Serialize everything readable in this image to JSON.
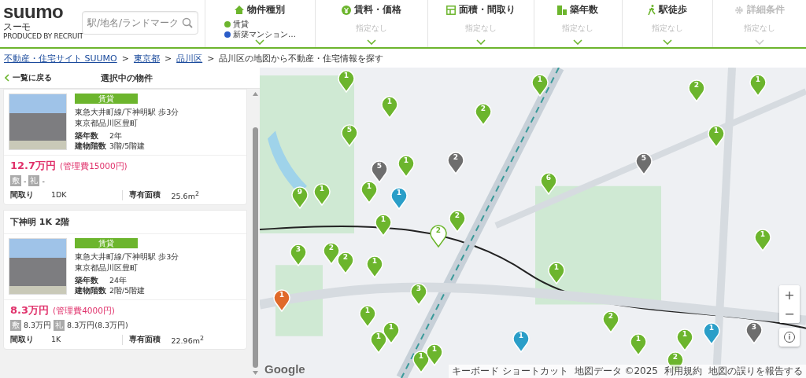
{
  "header": {
    "logo": "suumo",
    "logo_kana": "スーモ",
    "logo_credit": "PRODUCED BY RECRUIT",
    "search": {
      "placeholder": "駅/地名/ランドマーク"
    },
    "filters": [
      {
        "kind": "type",
        "label": "物件種別",
        "disabled": false,
        "values": [
          {
            "text": "賃貸",
            "color": "#6cb52d"
          },
          {
            "text": "新築マンション…",
            "color": "#2a5cc8"
          }
        ]
      },
      {
        "kind": "rent",
        "label": "賃料・価格",
        "disabled": false,
        "values": [
          {
            "text": "指定なし"
          }
        ]
      },
      {
        "kind": "area",
        "label": "面積・間取り",
        "disabled": false,
        "values": [
          {
            "text": "指定なし"
          }
        ]
      },
      {
        "kind": "age",
        "label": "築年数",
        "disabled": false,
        "values": [
          {
            "text": "指定なし"
          }
        ]
      },
      {
        "kind": "walk",
        "label": "駅徒歩",
        "disabled": false,
        "values": [
          {
            "text": "指定なし"
          }
        ]
      },
      {
        "kind": "detail",
        "label": "詳細条件",
        "disabled": true,
        "values": [
          {
            "text": "指定なし"
          }
        ]
      }
    ]
  },
  "breadcrumb": [
    {
      "text": "不動産・住宅サイト SUUMO",
      "link": true
    },
    {
      "separator": ">",
      "text": "東京都",
      "link": true
    },
    {
      "separator": ">",
      "text": "品川区",
      "link": true
    },
    {
      "separator": ">",
      "text": "品川区の地図から不動産・住宅情報を探す",
      "link": false
    }
  ],
  "panel": {
    "back": "一覧に戻る",
    "title": "選択中の物件",
    "cards": [
      {
        "tag": "賃貸",
        "access": "東急大井町線/下神明駅 歩3分",
        "address": "東京都品川区豊町",
        "age_label": "築年数",
        "age": "2年",
        "floors_label": "建物階数",
        "floors": "3階/5階建",
        "price": "12.7万円",
        "fee": "(管理費15000円)",
        "deposit_icon": "敷",
        "deposit": "-",
        "key_icon": "礼",
        "key_money": "-",
        "layout_label": "間取り",
        "layout": "1DK",
        "area_label": "専有面積",
        "area": "25.6m$^{2}$"
      },
      {
        "title": "下神明 1K 2階",
        "tag": "賃貸",
        "access": "東急大井町線/下神明駅 歩3分",
        "address": "東京都品川区豊町",
        "age_label": "築年数",
        "age": "24年",
        "floors_label": "建物階数",
        "floors": "2階/5階建",
        "price": "8.3万円",
        "fee": "(管理費4000円)",
        "deposit_icon": "敷",
        "deposit": "8.3万円",
        "key_icon": "礼",
        "key_money": "8.3万円(8.3万円)",
        "layout_label": "間取り",
        "layout": "1K",
        "area_label": "専有面積",
        "area": "22.96m$^{2}$"
      }
    ]
  },
  "map": {
    "pins": [
      {
        "count": "1",
        "color": "#6cb52d",
        "selected": false
      },
      {
        "count": "1",
        "color": "#6cb52d",
        "selected": false
      },
      {
        "count": "1",
        "color": "#6cb52d",
        "selected": false
      },
      {
        "count": "2",
        "color": "#6cb52d",
        "selected": false
      },
      {
        "count": "5",
        "color": "#6cb52d",
        "selected": false
      },
      {
        "count": "2",
        "color": "#6cb52d",
        "selected": false
      },
      {
        "count": "1",
        "color": "#6cb52d",
        "selected": false
      },
      {
        "count": "1",
        "color": "#6cb52d",
        "selected": false
      },
      {
        "count": "2",
        "color": "#6e6e6e",
        "selected": false
      },
      {
        "count": "5",
        "color": "#6e6e6e",
        "selected": false
      },
      {
        "count": "1",
        "color": "#6cb52d",
        "selected": false
      },
      {
        "count": "5",
        "color": "#6e6e6e",
        "selected": false
      },
      {
        "count": "9",
        "color": "#6cb52d",
        "selected": false
      },
      {
        "count": "1",
        "color": "#6cb52d",
        "selected": false
      },
      {
        "count": "1",
        "color": "#6cb52d",
        "selected": false
      },
      {
        "count": "1",
        "color": "#2a9ec8",
        "selected": false
      },
      {
        "count": "6",
        "color": "#6cb52d",
        "selected": false
      },
      {
        "count": "2",
        "color": "#6cb52d",
        "selected": false
      },
      {
        "count": "1",
        "color": "#6cb52d",
        "selected": false
      },
      {
        "count": "2",
        "color": "#6cb52d",
        "selected": true
      },
      {
        "count": "3",
        "color": "#6cb52d",
        "selected": false
      },
      {
        "count": "2",
        "color": "#6cb52d",
        "selected": false
      },
      {
        "count": "2",
        "color": "#6cb52d",
        "selected": false
      },
      {
        "count": "1",
        "color": "#6cb52d",
        "selected": false
      },
      {
        "count": "1",
        "color": "#6cb52d",
        "selected": false
      },
      {
        "count": "1",
        "color": "#6cb52d",
        "selected": false
      },
      {
        "count": "3",
        "color": "#6cb52d",
        "selected": false
      },
      {
        "count": "1",
        "color": "#e06a2a",
        "selected": false
      },
      {
        "count": "1",
        "color": "#6cb52d",
        "selected": false
      },
      {
        "count": "1",
        "color": "#6cb52d",
        "selected": false
      },
      {
        "count": "1",
        "color": "#6cb52d",
        "selected": false
      },
      {
        "count": "1",
        "color": "#6cb52d",
        "selected": false
      },
      {
        "count": "1",
        "color": "#6cb52d",
        "selected": false
      },
      {
        "count": "2",
        "color": "#6cb52d",
        "selected": false
      },
      {
        "count": "1",
        "color": "#2a9ec8",
        "selected": false
      },
      {
        "count": "1",
        "color": "#6cb52d",
        "selected": false
      },
      {
        "count": "1",
        "color": "#6cb52d",
        "selected": false
      },
      {
        "count": "1",
        "color": "#2a9ec8",
        "selected": false
      },
      {
        "count": "2",
        "color": "#6cb52d",
        "selected": false
      },
      {
        "count": "3",
        "color": "#6e6e6e",
        "selected": false
      }
    ],
    "zoom_in": "+",
    "zoom_out": "−",
    "info": "i",
    "google": "Google",
    "footer": [
      "キーボード ショートカット",
      "地図データ ©2025",
      "利用規約",
      "地図の誤りを報告する"
    ]
  }
}
